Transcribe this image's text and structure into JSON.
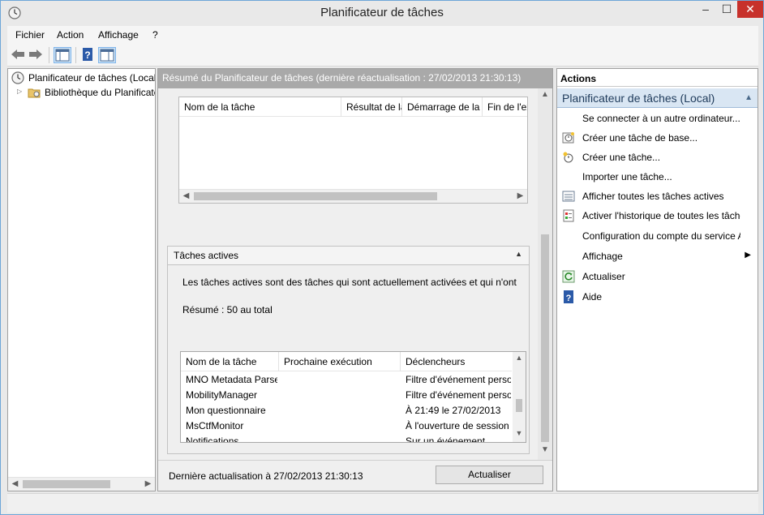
{
  "window": {
    "title": "Planificateur de tâches",
    "minimize": "‒",
    "maximize": "☐",
    "close": "✕"
  },
  "menu": [
    "Fichier",
    "Action",
    "Affichage",
    "?"
  ],
  "tree": {
    "root": "Planificateur de tâches (Local)",
    "child": "Bibliothèque du Planificateur de tâches"
  },
  "center": {
    "header": "Résumé du Planificateur de tâches (dernière réactualisation : 27/02/2013 21:30:13)",
    "top_grid": {
      "columns": [
        "Nom de la tâche",
        "Résultat de la dernière exécution",
        "Démarrage de la tâche",
        "Fin de l'exécution"
      ]
    },
    "active_section": {
      "title": "Tâches actives",
      "description": "Les tâches actives sont des tâches qui sont actuellement activées et qui n'ont",
      "summary": "Résumé : 50 au total"
    },
    "active_grid": {
      "columns": [
        "Nom de la tâche",
        "Prochaine exécution",
        "Déclencheurs"
      ],
      "rows": [
        {
          "name": "MNO Metadata Parser",
          "next": "",
          "trigger": "Filtre d'événement personnalisé"
        },
        {
          "name": "MobilityManager",
          "next": "",
          "trigger": "Filtre d'événement personnalisé"
        },
        {
          "name": "Mon questionnaire",
          "next": "",
          "trigger": "À 21:49 le 27/02/2013"
        },
        {
          "name": "MsCtfMonitor",
          "next": "",
          "trigger": "À l'ouverture de session de tout utilisateur"
        },
        {
          "name": "Notifications",
          "next": "",
          "trigger": "Sur un événement"
        }
      ]
    },
    "footer": {
      "last_update": "Dernière actualisation à 27/02/2013 21:30:13",
      "refresh_button": "Actualiser"
    }
  },
  "actions": {
    "title": "Actions",
    "group": "Planificateur de tâches (Local)",
    "items": [
      {
        "label": "Se connecter à un autre ordinateur...",
        "icon": "none"
      },
      {
        "label": "Créer une tâche de base...",
        "icon": "basic-task-icon"
      },
      {
        "label": "Créer une tâche...",
        "icon": "new-task-icon"
      },
      {
        "label": "Importer une tâche...",
        "icon": "none"
      },
      {
        "label": "Afficher toutes les tâches actives",
        "icon": "active-tasks-icon"
      },
      {
        "label": "Activer l'historique de toutes les tâches",
        "icon": "history-icon"
      },
      {
        "label": "Configuration du compte du service AT",
        "icon": "none"
      },
      {
        "label": "Affichage",
        "icon": "none",
        "submenu": "▶"
      },
      {
        "label": "Actualiser",
        "icon": "refresh-icon"
      },
      {
        "label": "Aide",
        "icon": "help-icon"
      }
    ]
  }
}
